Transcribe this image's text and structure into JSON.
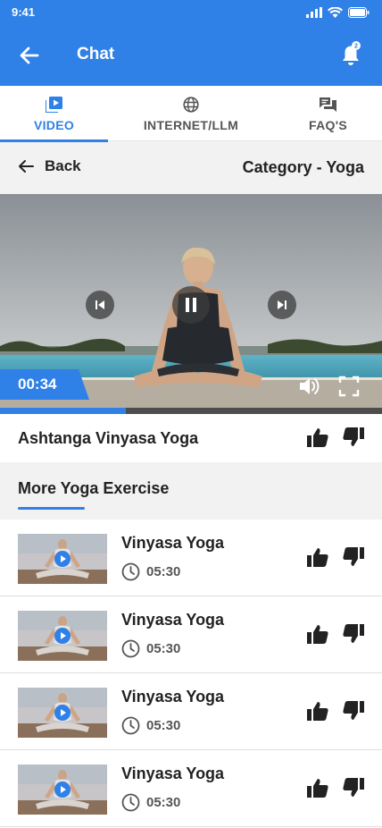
{
  "status_bar": {
    "time": "9:41"
  },
  "app_bar": {
    "title": "Chat",
    "notification_count": "2"
  },
  "tabs": [
    {
      "label": "VIDEO",
      "icon": "video-library-icon",
      "active": true
    },
    {
      "label": "INTERNET/LLM",
      "icon": "globe-icon",
      "active": false
    },
    {
      "label": "FAQ'S",
      "icon": "chat-bubbles-icon",
      "active": false
    }
  ],
  "sub_header": {
    "back_label": "Back",
    "category": "Category - Yoga"
  },
  "player": {
    "elapsed": "00:34",
    "progress": 0.33,
    "state": "playing",
    "title": "Ashtanga Vinyasa Yoga"
  },
  "section": {
    "title": "More Yoga Exercise"
  },
  "videos": [
    {
      "title": "Vinyasa Yoga",
      "duration": "05:30"
    },
    {
      "title": "Vinyasa Yoga",
      "duration": "05:30"
    },
    {
      "title": "Vinyasa Yoga",
      "duration": "05:30"
    },
    {
      "title": "Vinyasa Yoga",
      "duration": "05:30"
    }
  ],
  "colors": {
    "primary": "#2f80e7",
    "background_gray": "#f2f2f2",
    "text": "#222222"
  }
}
